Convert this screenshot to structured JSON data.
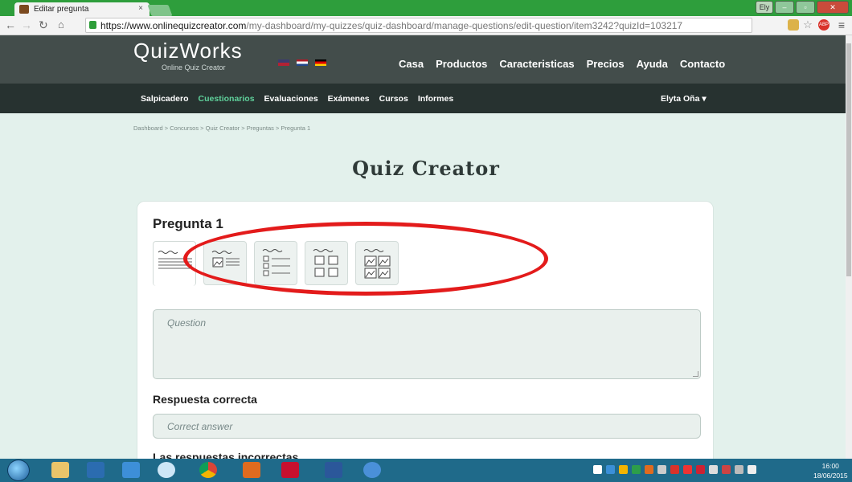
{
  "browser": {
    "tab_title": "Editar pregunta",
    "tab_close": "×",
    "url_host": "https://www.onlinequizcreator.com",
    "url_path": "/my-dashboard/my-quizzes/quiz-dashboard/manage-questions/edit-question/item3242?quizId=103217",
    "user_button": "Ely",
    "extension_abp": "ABP"
  },
  "site": {
    "logo_big": "QuizWorks",
    "logo_sub": "Online Quiz Creator",
    "topnav": [
      "Casa",
      "Productos",
      "Caracteristicas",
      "Precios",
      "Ayuda",
      "Contacto"
    ],
    "subnav": [
      "Salpicadero",
      "Cuestionarios",
      "Evaluaciones",
      "Exámenes",
      "Cursos",
      "Informes"
    ],
    "subnav_active": "Cuestionarios",
    "user_menu": "Elyta Oña ▾"
  },
  "breadcrumb": "Dashboard  >  Concursos  >  Quiz Creator  >  Preguntas  >  Pregunta 1",
  "page_title": "Quiz Creator",
  "editor": {
    "question_heading": "Pregunta 1",
    "question_placeholder": "Question",
    "correct_heading": "Respuesta correcta",
    "correct_placeholder": "Correct answer",
    "wrong_heading": "Las respuestas incorrectas"
  },
  "taskbar": {
    "time": "16:00",
    "date": "18/06/2015"
  },
  "colors": {
    "annotation": "#e31b1b",
    "active_nav": "#5fd19b",
    "header_bg": "#434d4b",
    "page_bg": "#e3f1ec"
  }
}
